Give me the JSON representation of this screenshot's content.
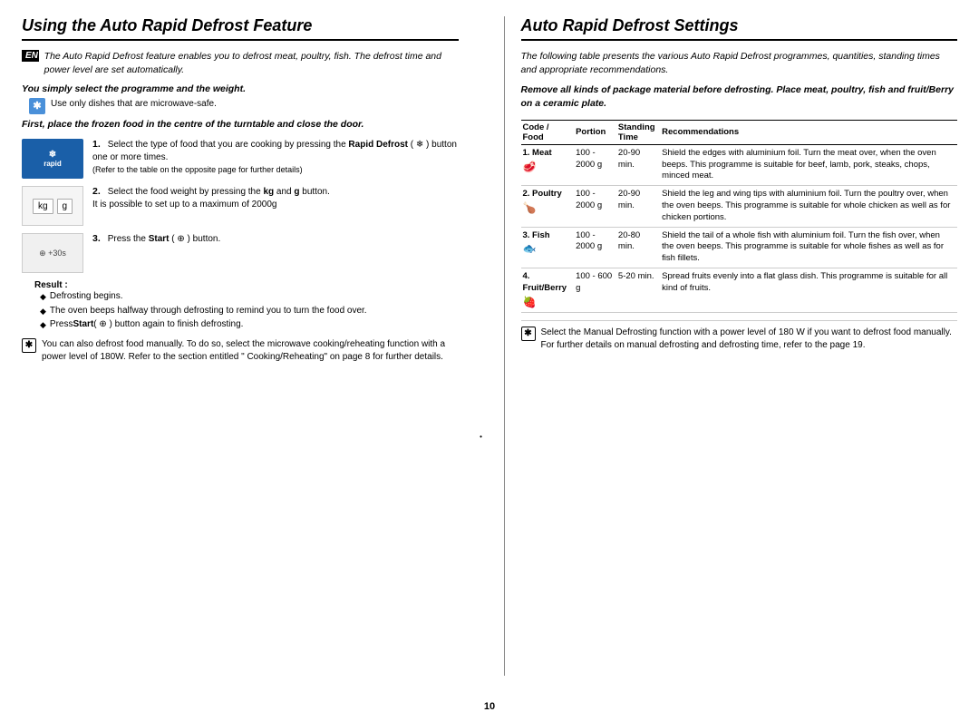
{
  "left": {
    "title": "Using the Auto Rapid Defrost Feature",
    "en_label": "EN",
    "intro": "The Auto Rapid Defrost feature enables you to defrost meat, poultry, fish. The defrost time and power level are set automatically.",
    "subheading1": "You simply select the programme and the weight.",
    "bullet1": "Use only dishes that are microwave-safe.",
    "subheading2": "First, place the frozen food in the centre of the turntable and close the door.",
    "steps": [
      {
        "num": "1.",
        "image_label": "rapid",
        "image_type": "rapid",
        "text": "Select the type of food that you are cooking by pressing the ",
        "bold": "Rapid Defrost",
        "bold2": "( )",
        "text2": " button one or more times.",
        "sub": "(Refer to the table on the opposite page for further details)"
      },
      {
        "num": "2.",
        "image_type": "kg-g",
        "text": "Select the food weight by pressing the ",
        "bold": "kg",
        "text2": " and ",
        "bold2": "g",
        "text3": " button.",
        "sub": "It is possible to set up to a maximum of 2000g"
      },
      {
        "num": "3.",
        "image_type": "start",
        "image_label": "⊕+30s",
        "text": "Press the ",
        "bold": "Start",
        "text2": " ( ⊕ ) button.",
        "result_label": "Result :",
        "diamonds": [
          "Defrosting begins.",
          "The oven beeps halfway through defrosting to remind you to turn the food over.",
          "Press Start ( ⊕ ) button again to finish defrosting."
        ]
      }
    ],
    "manual_info": "You can also defrost food manually. To do so, select the microwave cooking/reheating function with a power level of 180W. Refer to the section entitled \" Cooking/Reheating\" on page 8 for further details."
  },
  "right": {
    "title": "Auto Rapid Defrost Settings",
    "intro": "The following table presents the various Auto Rapid Defrost programmes, quantities, standing times and appropriate recommendations.",
    "bold_note": "Remove all kinds of package material before defrosting. Place meat, poultry, fish and fruit/Berry on a ceramic plate.",
    "table": {
      "headers": [
        "Code / Food",
        "Portion",
        "Standing Time",
        "Recommendations"
      ],
      "rows": [
        {
          "code": "1.",
          "food": "Meat",
          "icon": "🥩",
          "portion": "100 - 2000 g",
          "standing": "20-90 min.",
          "reco": "Shield the edges with aluminium foil. Turn the meat over, when the oven beeps. This programme is suitable for beef, lamb, pork, steaks, chops, minced meat."
        },
        {
          "code": "2.",
          "food": "Poultry",
          "icon": "🍗",
          "portion": "100 - 2000 g",
          "standing": "20-90 min.",
          "reco": "Shield the leg and wing tips with aluminium foil. Turn the poultry over, when the oven beeps. This programme is suitable for whole chicken as well as for chicken portions."
        },
        {
          "code": "3.",
          "food": "Fish",
          "icon": "🐟",
          "portion": "100 - 2000 g",
          "standing": "20-80 min.",
          "reco": "Shield the tail of a whole fish with aluminium foil. Turn the fish over, when the oven beeps. This programme is suitable for whole fishes as well as for fish fillets."
        },
        {
          "code": "4.",
          "food": "Fruit/Berry",
          "icon": "🍓",
          "portion": "100 - 600 g",
          "standing": "5-20 min.",
          "reco": "Spread fruits evenly into a flat glass dish. This programme is suitable for all kind of fruits."
        }
      ]
    },
    "footer": "Select the Manual Defrosting function with a power level of 180 W if you want to defrost food manually. For further details on manual defrosting and defrosting time, refer to the page 19."
  },
  "page_number": "10",
  "divider_bullet": "•"
}
